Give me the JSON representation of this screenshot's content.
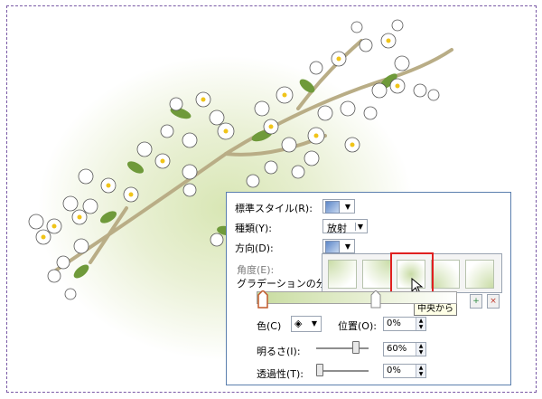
{
  "panel": {
    "preset_label": "標準スタイル(R):",
    "type_label": "種類(Y):",
    "type_value": "放射",
    "direction_label": "方向(D):",
    "angle_label": "角度(E):",
    "stops_label": "グラデーションの分岐",
    "color_label": "色(C)",
    "position_label": "位置(O):",
    "position_value": "0%",
    "brightness_label": "明るさ(I):",
    "brightness_value": "60%",
    "transparency_label": "透過性(T):",
    "transparency_value": "0%",
    "tooltip": "中央から"
  },
  "levels": {
    "brightness": 0.8,
    "transparency": 0.0,
    "selected_tile_index": 2
  },
  "colors": {
    "highlight_border": "#e02020",
    "panel_border": "#5b7fae",
    "gradient_green": "#c8dca0"
  },
  "icons": {
    "add_stop": "add-gradient-stop-icon",
    "remove_stop": "remove-gradient-stop-icon",
    "fill_color": "paint-bucket-icon",
    "cursor": "mouse-pointer-icon"
  }
}
